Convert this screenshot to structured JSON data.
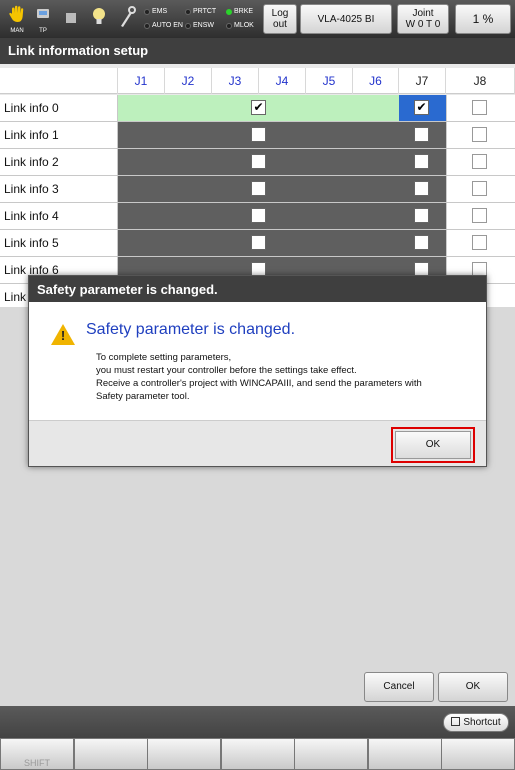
{
  "toolbar": {
    "icons": [
      {
        "name": "man-hand-icon",
        "label": "MAN"
      },
      {
        "name": "tp-icon",
        "label": "TP"
      },
      {
        "name": "stop-icon",
        "label": ""
      },
      {
        "name": "lightbulb-icon",
        "label": ""
      },
      {
        "name": "wrench-icon",
        "label": ""
      }
    ],
    "leds": [
      {
        "label": "EMS",
        "on": false
      },
      {
        "label": "AUTO EN",
        "on": false
      },
      {
        "label": "PRTCT",
        "on": false
      },
      {
        "label": "ENSW",
        "on": false
      },
      {
        "label": "BRKE",
        "on": true
      },
      {
        "label": "MLOK",
        "on": false
      }
    ],
    "logout_line1": "Log",
    "logout_line2": "out",
    "robot_model": "VLA-4025 BI",
    "joint_line1": "Joint",
    "joint_line2": "W 0 T 0",
    "speed": "1 %"
  },
  "page_title": "Link information setup",
  "table": {
    "columns": [
      "J1",
      "J2",
      "J3",
      "J4",
      "J5",
      "J6",
      "J7",
      "J8"
    ],
    "rows": [
      {
        "label": "Link info 0",
        "span_checked": true,
        "j7_checked": true,
        "j8_checked": false
      },
      {
        "label": "Link info 1",
        "span_checked": false,
        "j7_checked": false,
        "j8_checked": false
      },
      {
        "label": "Link info 2",
        "span_checked": false,
        "j7_checked": false,
        "j8_checked": false
      },
      {
        "label": "Link info 3",
        "span_checked": false,
        "j7_checked": false,
        "j8_checked": false
      },
      {
        "label": "Link info 4",
        "span_checked": false,
        "j7_checked": false,
        "j8_checked": false
      },
      {
        "label": "Link info 5",
        "span_checked": false,
        "j7_checked": false,
        "j8_checked": false
      },
      {
        "label": "Link info 6",
        "span_checked": false,
        "j7_checked": false,
        "j8_checked": false
      },
      {
        "label": "Link",
        "span_checked": false,
        "j7_checked": false,
        "j8_checked": false
      }
    ]
  },
  "dialog": {
    "title": "Safety parameter is changed.",
    "heading": "Safety parameter is changed.",
    "body": [
      "To complete setting parameters,",
      "you must restart your controller before the settings take effect.",
      "Receive a controller's project with WINCAPAIII, and send the parameters with",
      "Safety parameter tool."
    ],
    "ok_label": "OK"
  },
  "bottom": {
    "cancel_label": "Cancel",
    "ok_label": "OK"
  },
  "funcbar": {
    "shortcut_label": "Shortcut",
    "keys": [
      "SHIFT",
      "",
      "",
      "",
      "",
      "",
      "",
      ""
    ]
  }
}
